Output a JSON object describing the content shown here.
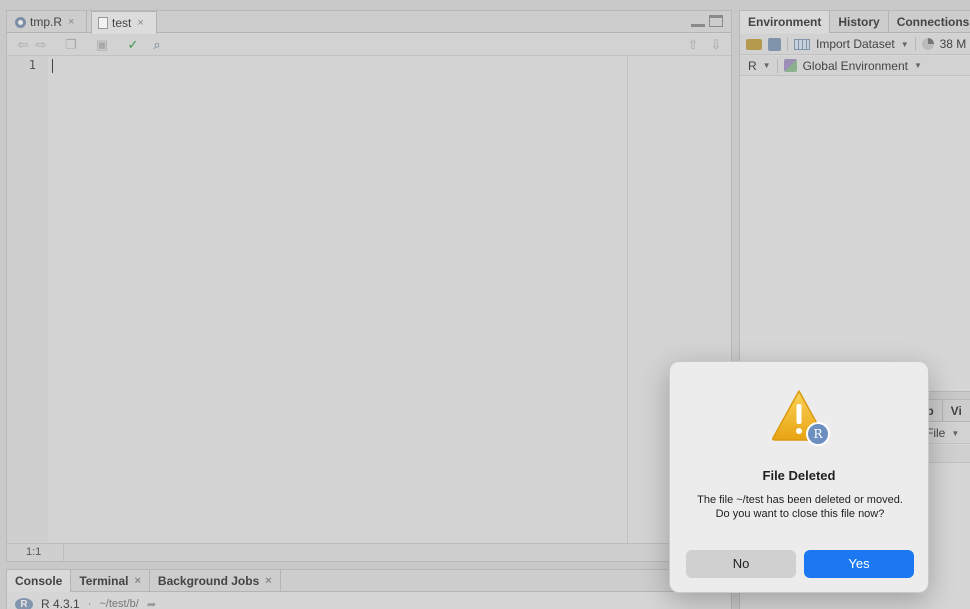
{
  "editor": {
    "tabs": [
      {
        "label": "tmp.R",
        "close": "×"
      },
      {
        "label": "test",
        "close": "×"
      }
    ],
    "line_number": "1",
    "cursor_position": "1:1"
  },
  "console": {
    "tabs": [
      {
        "label": "Console"
      },
      {
        "label": "Terminal",
        "close": "×"
      },
      {
        "label": "Background Jobs",
        "close": "×"
      }
    ],
    "r_version": "R 4.3.1",
    "separator": "·",
    "working_dir": "~/test/b/"
  },
  "environment": {
    "tabs": [
      "Environment",
      "History",
      "Connections"
    ],
    "import_dataset": "Import Dataset",
    "memory": "38 M",
    "language": "R",
    "scope": "Global Environment"
  },
  "files": {
    "tabs": [
      "lp",
      "Vi"
    ],
    "toolbar_label": "File"
  },
  "dialog": {
    "title": "File Deleted",
    "message": "The file ~/test has been deleted or moved. Do you want to close this file now?",
    "no_label": "No",
    "yes_label": "Yes",
    "badge_letter": "R"
  }
}
